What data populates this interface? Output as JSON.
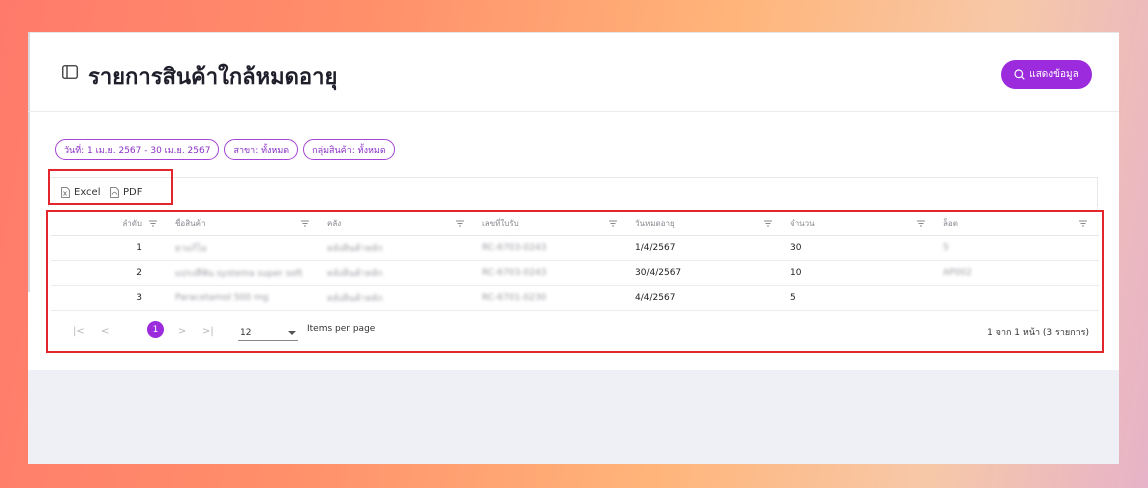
{
  "page": {
    "title": "รายการสินค้าใกล้หมดอายุ",
    "show_button_label": "แสดงข้อมูล"
  },
  "filters": [
    "วันที่: 1 เม.ย. 2567 - 30 เม.ย. 2567",
    "สาขา: ทั้งหมด",
    "กลุ่มสินค้า: ทั้งหมด"
  ],
  "export": {
    "excel_label": "Excel",
    "pdf_label": "PDF"
  },
  "table": {
    "columns": [
      "ลำดับ",
      "ชื่อสินค้า",
      "คลัง",
      "เลขที่ใบรับ",
      "วันหมดอายุ",
      "จำนวน",
      "ล็อต"
    ],
    "rows": [
      [
        "1",
        "ยาแก้ไอ",
        "คลังสินค้าหลัก",
        "RC-6703-0243",
        "1/4/2567",
        "30",
        "5"
      ],
      [
        "2",
        "แปรงสีฟัน systema super soft",
        "คลังสินค้าหลัก",
        "RC-6703-0243",
        "30/4/2567",
        "10",
        "AP002"
      ],
      [
        "3",
        "Paracetamol 500 mg",
        "คลังสินค้าหลัก",
        "RC-6701-0230",
        "4/4/2567",
        "5",
        ""
      ]
    ]
  },
  "pager": {
    "first": "|<",
    "prev": "<",
    "current_page": "1",
    "next": ">",
    "last": ">|",
    "items_per_page_value": "12",
    "items_per_page_label": "Items per page",
    "info": "1 จาก 1 หน้า (3 รายการ)"
  },
  "colors": {
    "accent": "#9b2bdc",
    "highlight_red": "#e3262b"
  }
}
